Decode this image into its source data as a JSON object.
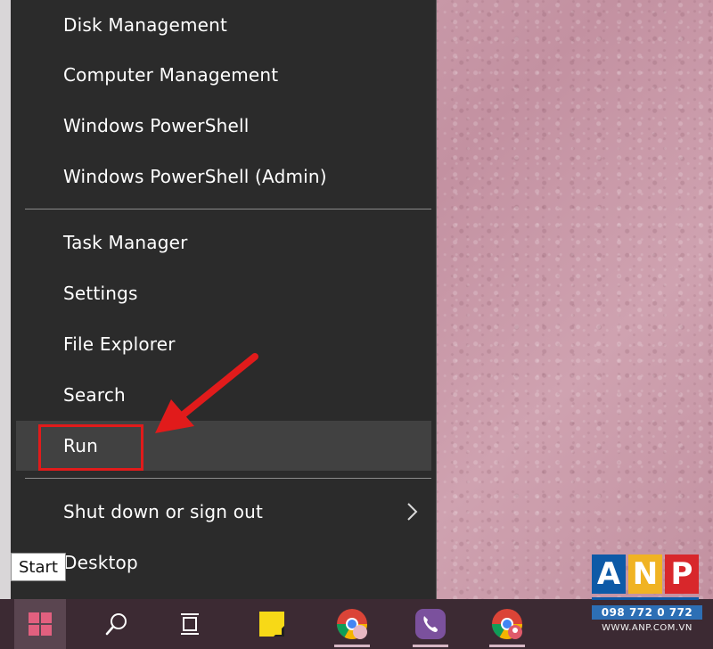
{
  "menu": {
    "group1": [
      {
        "label": "Disk Management"
      },
      {
        "label": "Computer Management"
      },
      {
        "label": "Windows PowerShell"
      },
      {
        "label": "Windows PowerShell (Admin)"
      }
    ],
    "group2": [
      {
        "label": "Task Manager"
      },
      {
        "label": "Settings"
      },
      {
        "label": "File Explorer"
      },
      {
        "label": "Search"
      },
      {
        "label": "Run"
      }
    ],
    "group3": [
      {
        "label": "Shut down or sign out",
        "icon": "chevron-right-icon"
      },
      {
        "label": "Desktop"
      }
    ],
    "highlighted_item": "Run"
  },
  "tooltip": {
    "text": "Start"
  },
  "taskbar": {
    "buttons": [
      {
        "name": "start-button",
        "icon": "windows-logo-icon"
      },
      {
        "name": "search-button",
        "icon": "search-icon"
      },
      {
        "name": "task-view-button",
        "icon": "task-view-icon"
      },
      {
        "name": "sticky-notes-button",
        "icon": "sticky-notes-icon"
      },
      {
        "name": "chrome-button",
        "icon": "chrome-icon"
      },
      {
        "name": "viber-button",
        "icon": "viber-icon"
      },
      {
        "name": "chrome-profile-button",
        "icon": "chrome-profile-icon"
      }
    ]
  },
  "watermark": {
    "letters": [
      "A",
      "N",
      "P"
    ],
    "phone": "098 772 0 772",
    "site": "WWW.ANP.COM.VN"
  },
  "colors": {
    "menu_bg": "#2b2b2b",
    "menu_hover": "#414141",
    "highlight_red": "#e11b1b",
    "desktop_pink": "#c79aa8",
    "taskbar_bg": "#3c2a33",
    "windows_logo": "#e2607f"
  }
}
